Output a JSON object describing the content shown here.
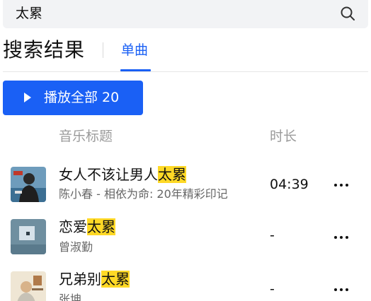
{
  "search": {
    "query": "太累"
  },
  "header": {
    "title": "搜索结果",
    "tab_singles": "单曲"
  },
  "play_all": {
    "label": "播放全部 20"
  },
  "columns": {
    "title": "音乐标题",
    "duration": "时长"
  },
  "songs": [
    {
      "title_prefix": "女人不该让男人",
      "title_highlight": "太累",
      "subtitle": "陈小春 - 相依为命: 20年精彩印记",
      "duration": "04:39"
    },
    {
      "title_prefix": "恋爱",
      "title_highlight": "太累",
      "subtitle": "曾淑勤",
      "duration": "-"
    },
    {
      "title_prefix": "兄弟别",
      "title_highlight": "太累",
      "subtitle": "张坤",
      "duration": "-"
    }
  ],
  "colors": {
    "accent": "#1a60f5",
    "highlight": "#ffd926",
    "muted": "#9b9b9b"
  },
  "icons": {
    "search": "search-icon",
    "more": "more-icon",
    "play": "play-icon"
  }
}
